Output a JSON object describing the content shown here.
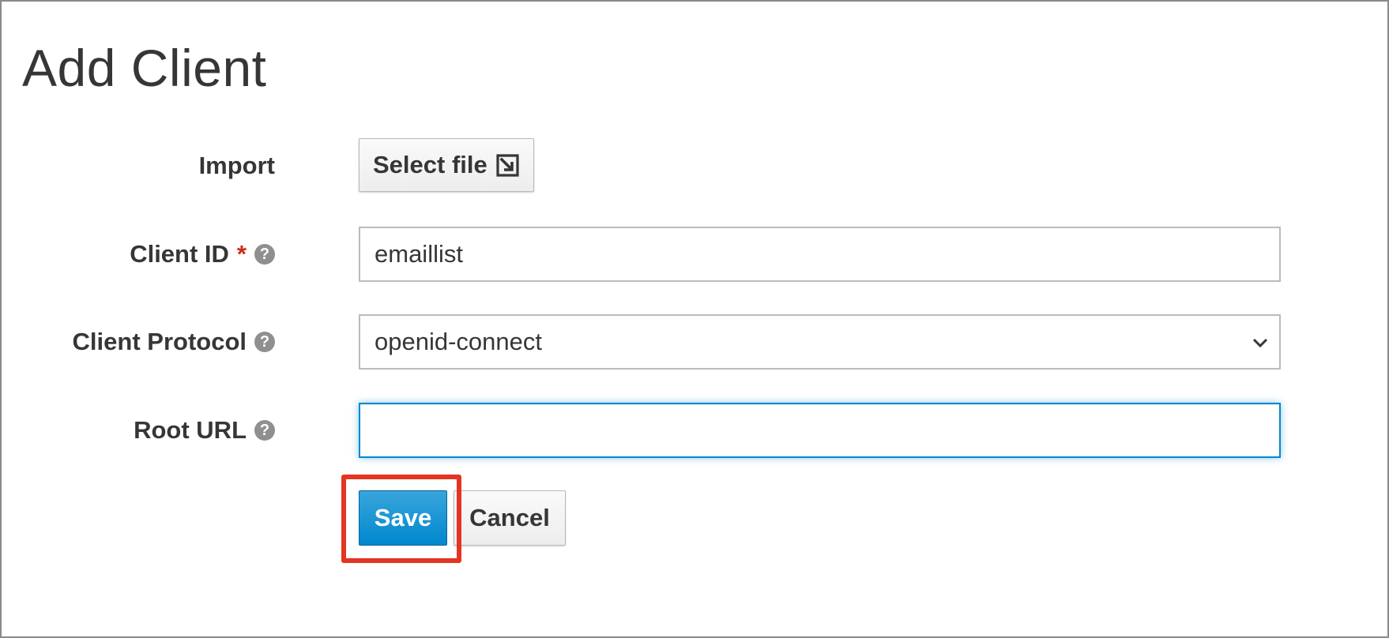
{
  "page": {
    "title": "Add Client"
  },
  "form": {
    "import": {
      "label": "Import",
      "button_label": "Select file",
      "button_icon": "import-icon"
    },
    "client_id": {
      "label": "Client ID",
      "required_marker": "*",
      "help_icon": "question-circle-icon",
      "value": "emaillist"
    },
    "client_protocol": {
      "label": "Client Protocol",
      "help_icon": "question-circle-icon",
      "selected": "openid-connect"
    },
    "root_url": {
      "label": "Root URL",
      "help_icon": "question-circle-icon",
      "value": "",
      "focused": true
    }
  },
  "actions": {
    "save_label": "Save",
    "cancel_label": "Cancel",
    "highlighted": "save"
  },
  "colors": {
    "primary": "#0088ce",
    "required": "#cc2a1b",
    "highlight": "#e43522",
    "text": "#363636"
  }
}
